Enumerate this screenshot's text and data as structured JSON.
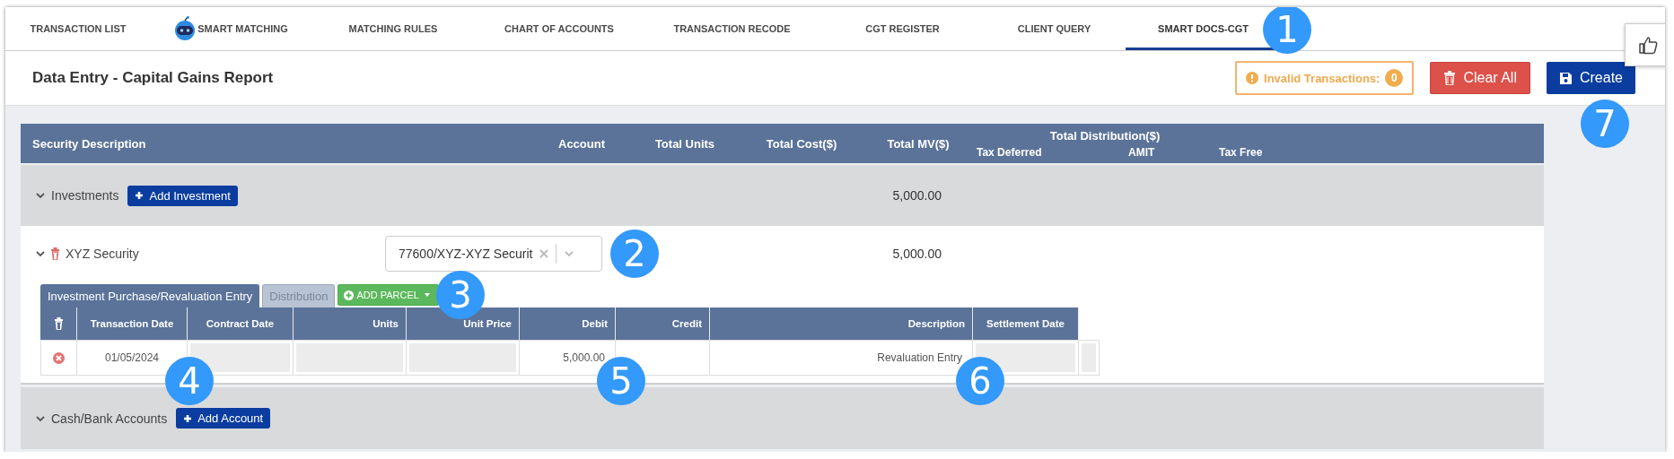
{
  "tabs": [
    {
      "label": "TRANSACTION LIST",
      "selected": false,
      "kind": "plain"
    },
    {
      "label": "SMART MATCHING",
      "selected": false,
      "kind": "robot"
    },
    {
      "label": "MATCHING RULES",
      "selected": false,
      "kind": "plain"
    },
    {
      "label": "CHART OF ACCOUNTS",
      "selected": false,
      "kind": "plain"
    },
    {
      "label": "TRANSACTION RECODE",
      "selected": false,
      "kind": "plain"
    },
    {
      "label": "CGT REGISTER",
      "selected": false,
      "kind": "plain"
    },
    {
      "label": "CLIENT QUERY",
      "selected": false,
      "kind": "plain"
    },
    {
      "label": "SMART DOCS-CGT",
      "selected": true,
      "kind": "plain"
    }
  ],
  "header": {
    "title": "Data Entry - Capital Gains Report",
    "invalid_label": "Invalid Transactions:",
    "invalid_count": "0",
    "buttons": [
      {
        "label": "Clear All",
        "kind": "danger"
      },
      {
        "label": "Create",
        "kind": "primary"
      }
    ]
  },
  "table": {
    "columns": [
      "Security Description",
      "Account",
      "Total Units",
      "Total Cost($)",
      "Total MV($)"
    ],
    "distribution": {
      "title": "Total Distribution($)",
      "columns": [
        "Tax Deferred",
        "AMIT",
        "Tax Free"
      ]
    },
    "sections": [
      {
        "label": "Investments",
        "expanded": true,
        "button": "Add Investment",
        "total_mv": "5,000.00",
        "securities": [
          {
            "name": "XYZ Security",
            "expanded": true,
            "account": "77600/XYZ-XYZ Securit",
            "total_mv": "5,000.00",
            "tabs": [
              {
                "label": "Investment Purchase/Revaluation Entry",
                "selected": true
              },
              {
                "label": "Distribution",
                "selected": false
              }
            ],
            "add_button": "ADD PARCEL",
            "entries": {
              "columns": [
                "Transaction Date",
                "Contract Date",
                "Units",
                "Unit Price",
                "Debit",
                "Credit",
                "Description",
                "Settlement Date"
              ],
              "rows": [
                {
                  "cells": [
                    {
                      "value": "01/05/2024",
                      "disabled": false
                    },
                    {
                      "disabled": true
                    },
                    {
                      "disabled": true
                    },
                    {
                      "disabled": true
                    },
                    {
                      "value": "5,000.00",
                      "disabled": false
                    },
                    {
                      "disabled": false
                    },
                    {
                      "value": "Revaluation Entry",
                      "disabled": false
                    },
                    {
                      "disabled": true
                    },
                    {
                      "disabled": true
                    }
                  ]
                }
              ]
            }
          }
        ]
      },
      {
        "label": "Cash/Bank Accounts",
        "expanded": true,
        "button": "Add Account"
      }
    ]
  },
  "annotations": [
    {
      "label": "1"
    },
    {
      "label": "2"
    },
    {
      "label": "3"
    },
    {
      "label": "4"
    },
    {
      "label": "5"
    },
    {
      "label": "6"
    },
    {
      "label": "7"
    }
  ]
}
